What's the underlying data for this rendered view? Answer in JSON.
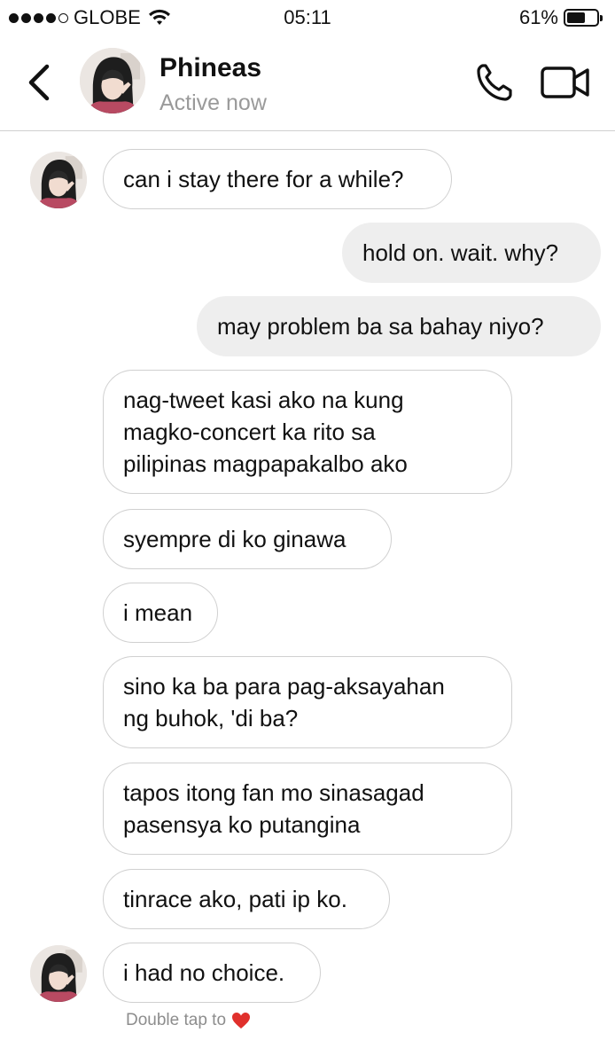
{
  "status_bar": {
    "carrier": "GLOBE",
    "time": "05:11",
    "battery_percent": "61%",
    "battery_level": 0.61,
    "signal_bars_filled": 4,
    "signal_bars_total": 5
  },
  "header": {
    "contact_name": "Phineas",
    "contact_status": "Active now",
    "icons": [
      "back-chevron-icon",
      "phone-icon",
      "video-camera-icon"
    ]
  },
  "messages": [
    {
      "side": "in",
      "lines": [
        "can i stay there for a while?"
      ]
    },
    {
      "side": "out",
      "lines": [
        "hold on. wait. why?"
      ]
    },
    {
      "side": "out",
      "lines": [
        "may problem ba sa bahay niyo?"
      ]
    },
    {
      "side": "in",
      "lines": [
        "nag-tweet kasi ako na kung",
        "magko-concert ka rito sa",
        "pilipinas magpapakalbo ako"
      ]
    },
    {
      "side": "in",
      "lines": [
        "syempre di ko ginawa"
      ]
    },
    {
      "side": "in",
      "lines": [
        "i mean"
      ]
    },
    {
      "side": "in",
      "lines": [
        "sino ka ba para pag-aksayahan",
        "ng buhok, 'di ba?"
      ]
    },
    {
      "side": "in",
      "lines": [
        "tapos itong fan mo sinasagad",
        "pasensya ko putangina"
      ]
    },
    {
      "side": "in",
      "lines": [
        "tinrace ako, pati ip ko."
      ]
    },
    {
      "side": "in",
      "lines": [
        "i had no choice."
      ]
    }
  ],
  "footer": {
    "hint_text": "Double tap to",
    "hint_icon": "heart-icon",
    "heart_color": "#e0302c"
  }
}
